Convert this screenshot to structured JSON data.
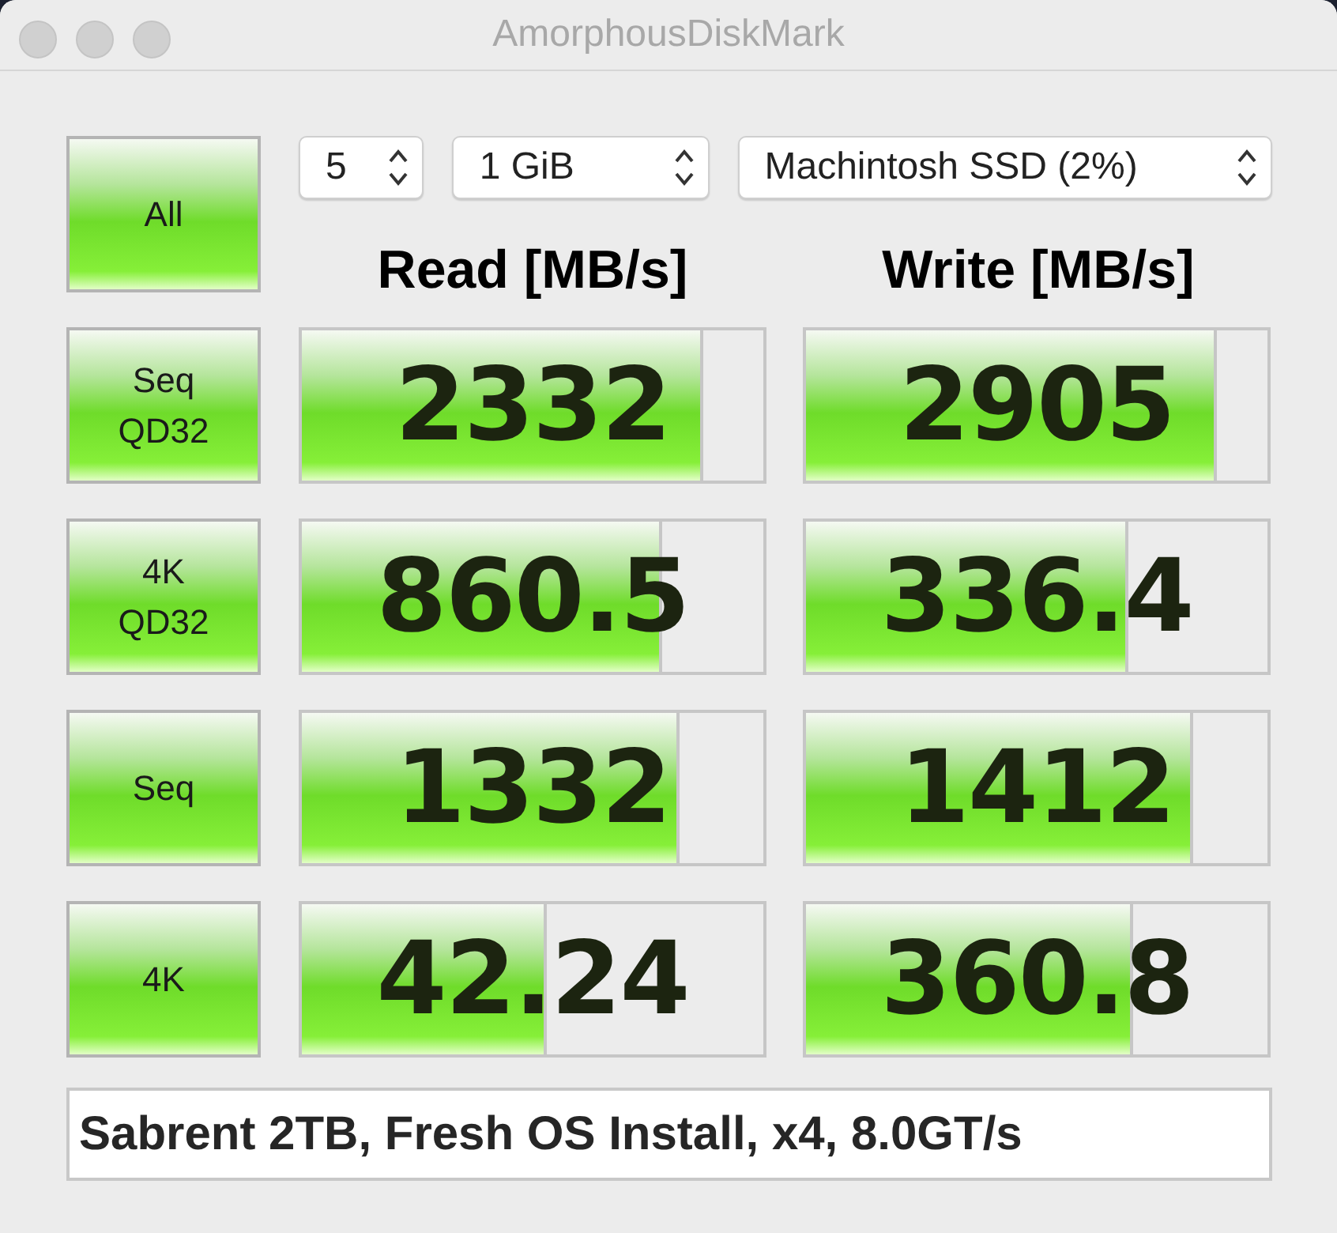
{
  "window": {
    "title": "AmorphousDiskMark"
  },
  "all_button": {
    "label": "All"
  },
  "selectors": [
    {
      "value": "5"
    },
    {
      "value": "1 GiB"
    },
    {
      "value": "Machintosh SSD (2%)"
    }
  ],
  "headings": [
    "Read [MB/s]",
    "Write [MB/s]"
  ],
  "tests": [
    {
      "label": "Seq\nQD32",
      "read": {
        "value": "2332",
        "level": 0.87
      },
      "write": {
        "value": "2905",
        "level": 0.89
      }
    },
    {
      "label": "4K\nQD32",
      "read": {
        "value": "860.5",
        "level": 0.78
      },
      "write": {
        "value": "336.4",
        "level": 0.7
      }
    },
    {
      "label": "Seq",
      "read": {
        "value": "1332",
        "level": 0.82
      },
      "write": {
        "value": "1412",
        "level": 0.84
      }
    },
    {
      "label": "4K",
      "read": {
        "value": "42.24",
        "level": 0.53
      },
      "write": {
        "value": "360.8",
        "level": 0.71
      }
    }
  ],
  "comment": {
    "value": "Sabrent 2TB, Fresh OS Install, x4, 8.0GT/s"
  }
}
